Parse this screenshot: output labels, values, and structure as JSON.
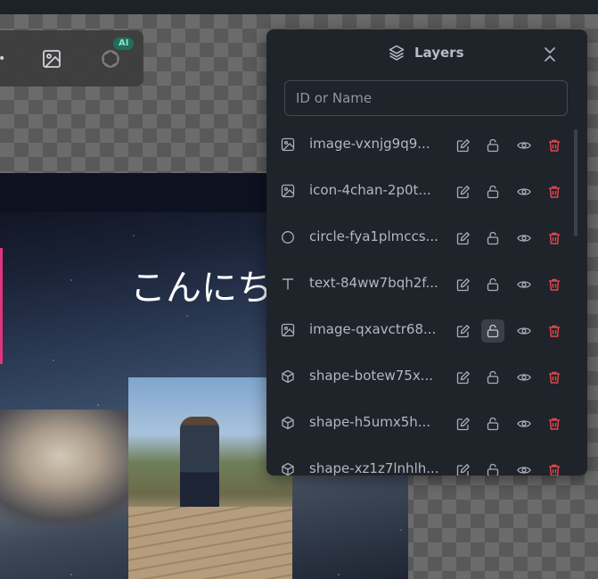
{
  "canvas": {
    "greeting_text": "こんにち"
  },
  "toolbar": {
    "ai_badge": "AI",
    "icons": [
      "image-icon",
      "openai-icon"
    ]
  },
  "layers_panel": {
    "title": "Layers",
    "search": {
      "placeholder": "ID or Name",
      "value": ""
    },
    "items": [
      {
        "name": "image-vxnjg9q9...",
        "type": "image",
        "locked_highlight": false
      },
      {
        "name": "icon-4chan-2p0t...",
        "type": "image",
        "locked_highlight": false
      },
      {
        "name": "circle-fya1plmccs...",
        "type": "circle",
        "locked_highlight": false
      },
      {
        "name": "text-84ww7bqh2f...",
        "type": "text",
        "locked_highlight": false
      },
      {
        "name": "image-qxavctr68...",
        "type": "image",
        "locked_highlight": true
      },
      {
        "name": "shape-botew75x...",
        "type": "shape",
        "locked_highlight": false
      },
      {
        "name": "shape-h5umx5h...",
        "type": "shape",
        "locked_highlight": false
      },
      {
        "name": "shape-xz1z7lnhlh...",
        "type": "shape",
        "locked_highlight": false
      }
    ]
  },
  "colors": {
    "panel_bg": "#1f232a",
    "delete_red": "#e5484d",
    "ai_badge_bg": "#1f6f5c",
    "highlight_pink": "#e0357e"
  }
}
